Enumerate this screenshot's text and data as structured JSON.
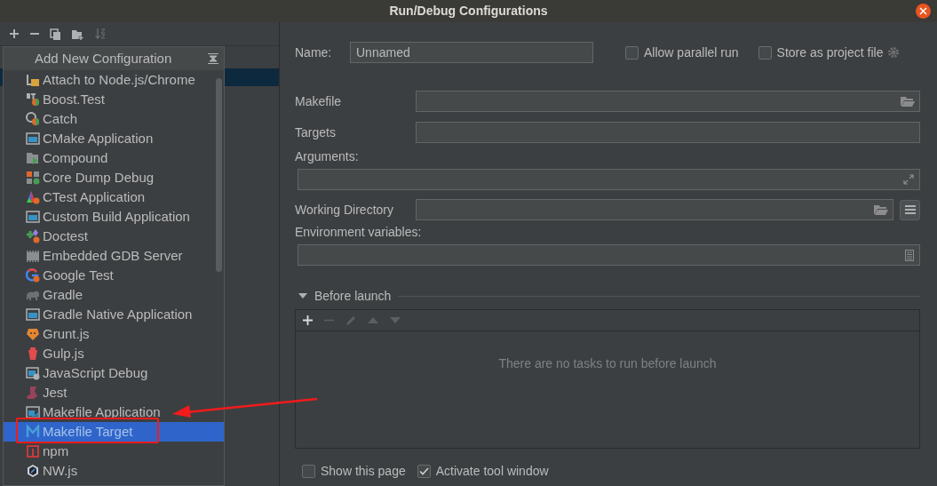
{
  "window": {
    "title": "Run/Debug Configurations"
  },
  "popup": {
    "title": "Add New Configuration",
    "items": [
      {
        "label": "Attach to Node.js/Chrome",
        "selected": false
      },
      {
        "label": "Boost.Test",
        "selected": false
      },
      {
        "label": "Catch",
        "selected": false
      },
      {
        "label": "CMake Application",
        "selected": false
      },
      {
        "label": "Compound",
        "selected": false
      },
      {
        "label": "Core Dump Debug",
        "selected": false
      },
      {
        "label": "CTest Application",
        "selected": false
      },
      {
        "label": "Custom Build Application",
        "selected": false
      },
      {
        "label": "Doctest",
        "selected": false
      },
      {
        "label": "Embedded GDB Server",
        "selected": false
      },
      {
        "label": "Google Test",
        "selected": false
      },
      {
        "label": "Gradle",
        "selected": false
      },
      {
        "label": "Gradle Native Application",
        "selected": false
      },
      {
        "label": "Grunt.js",
        "selected": false
      },
      {
        "label": "Gulp.js",
        "selected": false
      },
      {
        "label": "JavaScript Debug",
        "selected": false
      },
      {
        "label": "Jest",
        "selected": false
      },
      {
        "label": "Makefile Application",
        "selected": false
      },
      {
        "label": "Makefile Target",
        "selected": true
      },
      {
        "label": "npm",
        "selected": false
      },
      {
        "label": "NW.js",
        "selected": false
      }
    ]
  },
  "form": {
    "name_label": "Name:",
    "name_value": "Unnamed",
    "options": [
      {
        "label": "Allow parallel run",
        "checked": false
      },
      {
        "label": "Store as project file",
        "checked": false
      }
    ],
    "makefile_label": "Makefile",
    "targets_label": "Targets",
    "arguments_label": "Arguments:",
    "working_directory_label": "Working Directory",
    "environment_label": "Environment variables:"
  },
  "before_launch": {
    "title": "Before launch",
    "expanded": true,
    "empty_text": "There are no tasks to run before launch"
  },
  "footer_options": [
    {
      "label": "Show this page",
      "checked": false
    },
    {
      "label": "Activate tool window",
      "checked": true
    }
  ]
}
